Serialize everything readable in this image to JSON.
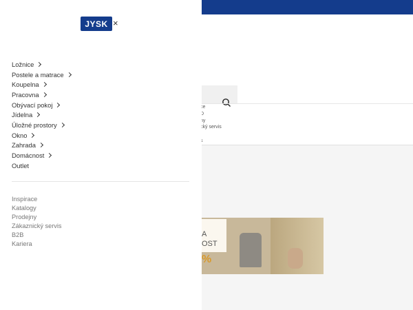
{
  "brand": {
    "logo_text": "JYSK",
    "close_symbol": "×",
    "color": "#143c8c"
  },
  "menu_items": [
    {
      "label": "Ložnice",
      "has_sub": true
    },
    {
      "label": "Postele a matrace",
      "has_sub": true
    },
    {
      "label": "Koupelna",
      "has_sub": true
    },
    {
      "label": "Pracovna",
      "has_sub": true
    },
    {
      "label": "Obývací pokoj",
      "has_sub": true
    },
    {
      "label": "Jídelna",
      "has_sub": true
    },
    {
      "label": "Úložné prostory",
      "has_sub": true
    },
    {
      "label": "Okno",
      "has_sub": true
    },
    {
      "label": "Zahrada",
      "has_sub": true
    },
    {
      "label": "Domácnost",
      "has_sub": true
    },
    {
      "label": "Outlet",
      "has_sub": false
    }
  ],
  "secondary_links": [
    "Inspirace",
    "Katalogy",
    "Prodejny",
    "Zákaznický servis",
    "B2B",
    "Kariera"
  ],
  "background_peek": {
    "lines": [
      "ce",
      "D",
      "ny",
      "cký servis",
      "s"
    ]
  },
  "banner": {
    "line1": "A",
    "line2": "OST",
    "percent": "%"
  }
}
